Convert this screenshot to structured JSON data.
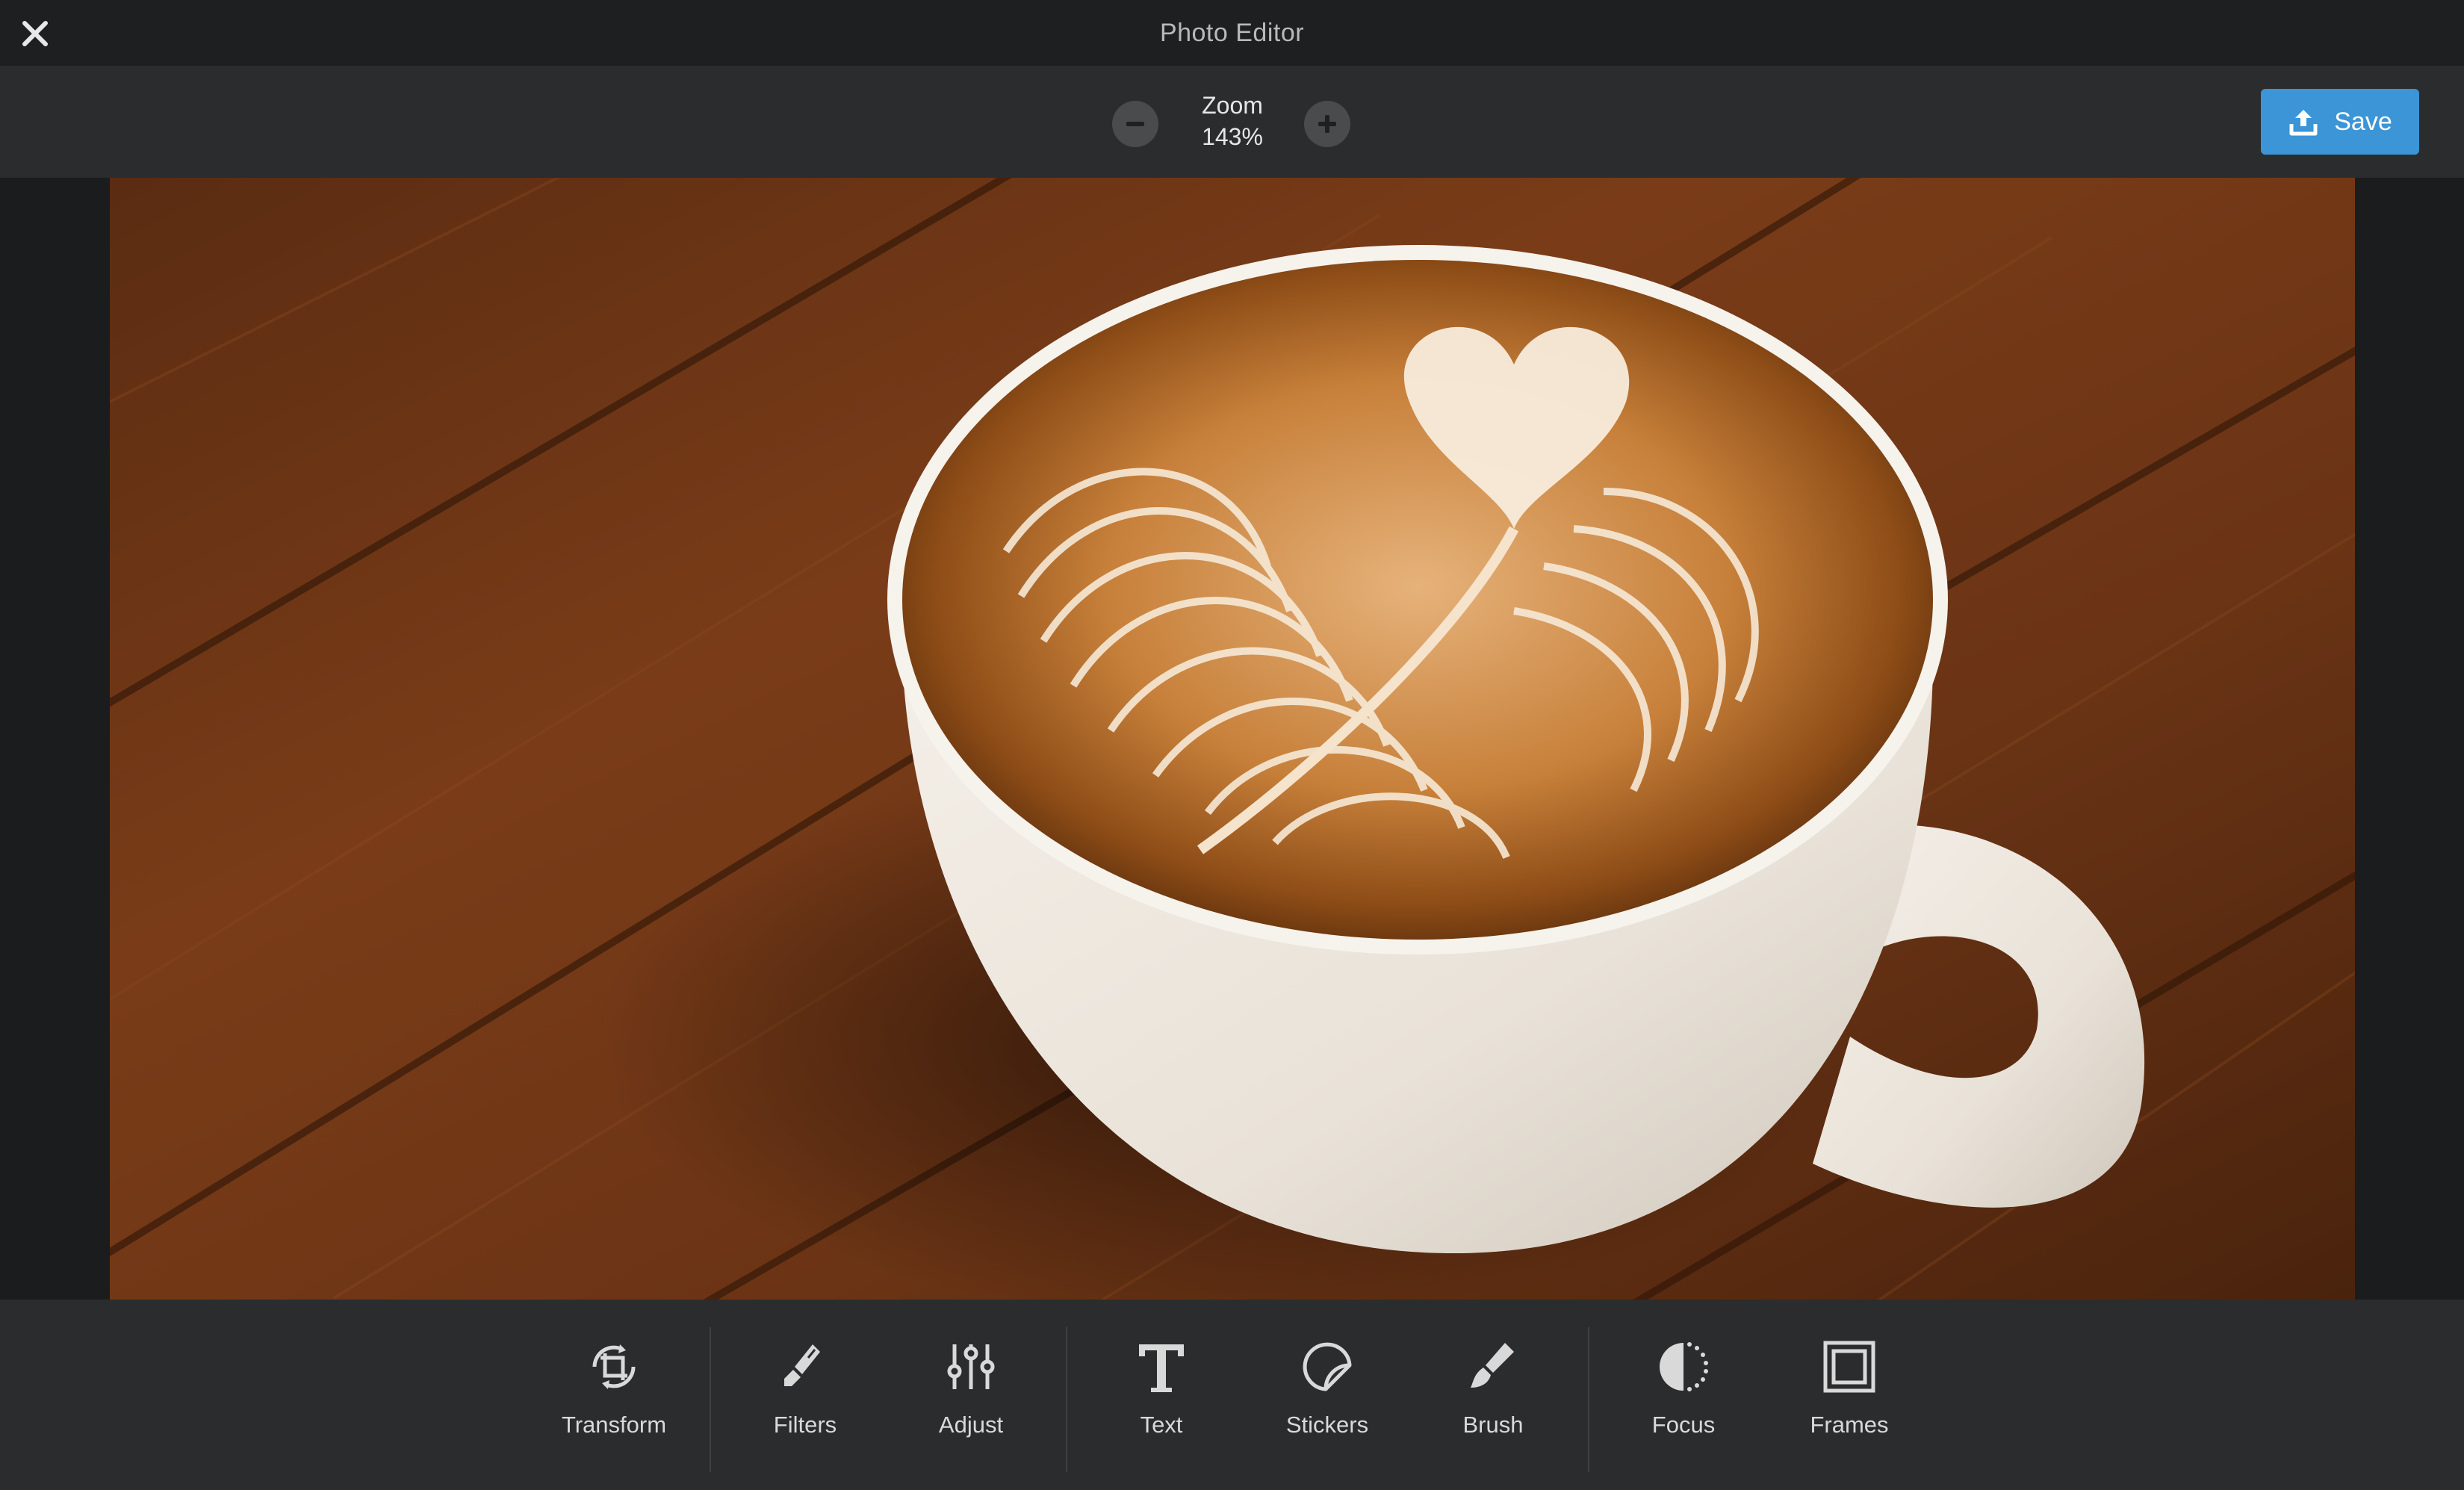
{
  "window": {
    "title": "Photo Editor"
  },
  "toolbar": {
    "zoom_label": "Zoom",
    "zoom_value": "143%",
    "save_label": "Save"
  },
  "colors": {
    "background": "#1b1c1d",
    "bar": "#2b2c2d",
    "accent": "#3b95d6",
    "text": "#d9d9d9"
  },
  "photo": {
    "subject": "latte-art coffee cup on wooden table"
  },
  "tools": [
    {
      "label": "Transform",
      "icon": "transform-icon"
    },
    {
      "label": "Filters",
      "icon": "filters-icon"
    },
    {
      "label": "Adjust",
      "icon": "adjust-icon"
    },
    {
      "label": "Text",
      "icon": "text-icon"
    },
    {
      "label": "Stickers",
      "icon": "stickers-icon"
    },
    {
      "label": "Brush",
      "icon": "brush-icon"
    },
    {
      "label": "Focus",
      "icon": "focus-icon"
    },
    {
      "label": "Frames",
      "icon": "frames-icon"
    }
  ]
}
